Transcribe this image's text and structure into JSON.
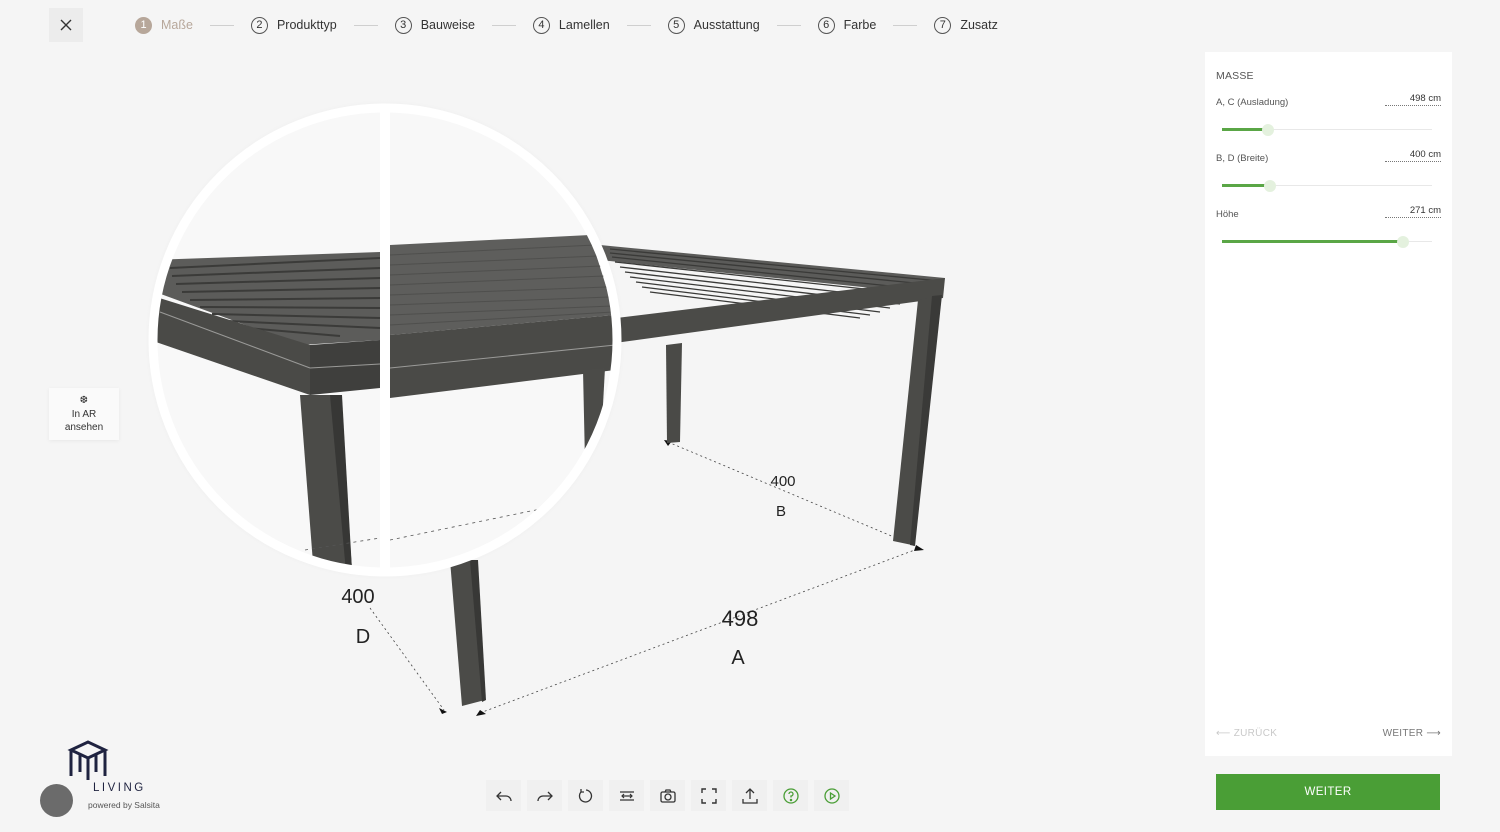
{
  "header": {
    "steps": [
      {
        "num": "1",
        "label": "Maße"
      },
      {
        "num": "2",
        "label": "Produkttyp"
      },
      {
        "num": "3",
        "label": "Bauweise"
      },
      {
        "num": "4",
        "label": "Lamellen"
      },
      {
        "num": "5",
        "label": "Ausstattung"
      },
      {
        "num": "6",
        "label": "Farbe"
      },
      {
        "num": "7",
        "label": "Zusatz"
      }
    ],
    "active_step": 1
  },
  "viewer": {
    "ar_button": {
      "line1": "In AR",
      "line2": "ansehen"
    },
    "dimensions": {
      "a_value": "498",
      "a_letter": "A",
      "b_value": "400",
      "b_letter": "B",
      "d_value": "400",
      "d_letter": "D"
    }
  },
  "panel": {
    "title": "MASSE",
    "fields": [
      {
        "label": "A, C (Ausladung)",
        "value": "498 cm",
        "level": 0.22
      },
      {
        "label": "B, D (Breite)",
        "value": "400 cm",
        "level": 0.23
      },
      {
        "label": "Höhe",
        "value": "271 cm",
        "level": 0.86
      }
    ],
    "back_label": "ZURÜCK",
    "next_label": "WEITER"
  },
  "weiter_button": "WEITER",
  "toolbar": {
    "tools": [
      "undo-icon",
      "redo-icon",
      "reset-icon",
      "measure-icon",
      "screenshot-icon",
      "fullscreen-icon",
      "share-icon",
      "help-icon",
      "play-icon"
    ]
  },
  "branding": {
    "logo_text": "LIVING",
    "powered_by": "powered by Salsita"
  },
  "colors": {
    "accent": "#4a9e36",
    "active_step": "#b7a79a",
    "pergola": "#4b4b48"
  }
}
